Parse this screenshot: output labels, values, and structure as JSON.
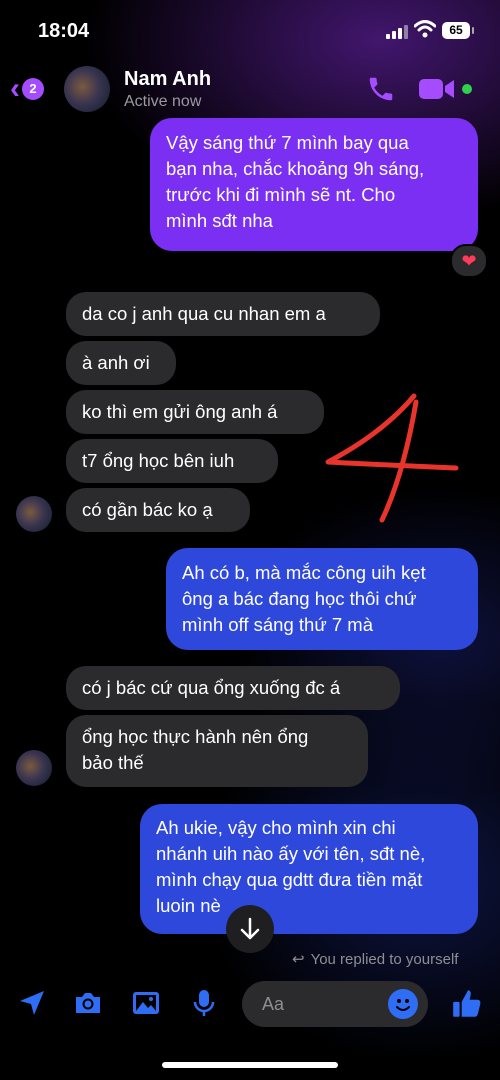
{
  "status_bar": {
    "time": "18:04",
    "battery": "65"
  },
  "header": {
    "back_count": "2",
    "contact_name": "Nam Anh",
    "contact_status": "Active now"
  },
  "messages": {
    "out_1": "Vậy sáng thứ 7 mình bay qua\nbạn nha, chắc khoảng 9h sáng,\ntrước khi đi mình sẽ nt. Cho\nmình sđt nha",
    "reaction": "❤",
    "in_1": "da co j anh qua cu nhan em a",
    "in_2": "à anh ơi",
    "in_3": "ko thì em gửi ông anh á",
    "in_4": "t7 ổng học bên iuh",
    "in_5": "có gần bác ko ạ",
    "out_2": "Ah có b, mà mắc công uih kẹt\nông a bác đang học thôi chứ\nmình off sáng thứ 7 mà",
    "in_6": "có j bác cứ qua ổng xuống đc á",
    "in_7": "ổng học thực hành nên ổng\nbảo thế",
    "out_3": "Ah ukie, vậy cho mình xin chi\nnhánh uih nào ấy với tên, sđt nè,\nmình chạy qua gdtt đưa tiền mặt\nluoin nè"
  },
  "annotation": {
    "handwritten": "4",
    "color": "#e8342a"
  },
  "replied_note": "You replied to yourself",
  "composer": {
    "placeholder": "Aa"
  },
  "colors": {
    "accent": "#a54cff",
    "bubble_purple": "#7b2ff2",
    "bubble_blue": "#2f48dc",
    "incoming": "#2b2b2e",
    "icon_blue": "#2f6df5"
  }
}
